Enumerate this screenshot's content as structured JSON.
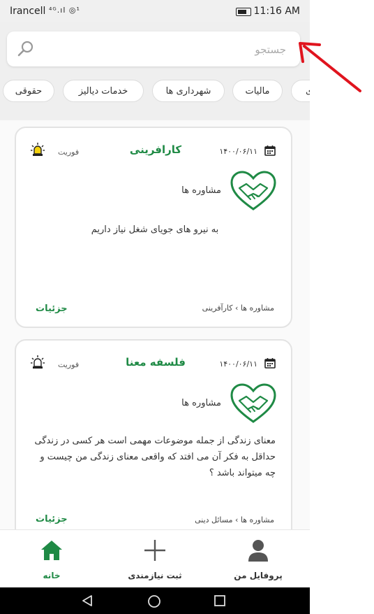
{
  "status_bar": {
    "carrier": "Irancell",
    "signal": "⁴ᴳ.ıl ◎¹",
    "time": "11:16 AM"
  },
  "search": {
    "placeholder": "جستجو",
    "value": ""
  },
  "categories": [
    "حقوقی",
    "خدمات دیالیز",
    "شهرداری ها",
    "مالیات",
    "ی"
  ],
  "cards": [
    {
      "date": "۱۴۰۰/۰۶/۱۱",
      "title": "کارافرینی",
      "urgent_label": "فوریت",
      "category": "مشاوره ها",
      "description": "به نیرو های جویای شغل نیاز داریم",
      "breadcrumb_parent": "مشاوره ها",
      "breadcrumb_sep": "›",
      "breadcrumb_child": "کارآفرینی",
      "details_label": "جزئیات"
    },
    {
      "date": "۱۴۰۰/۰۶/۱۱",
      "title": "فلسفه معنا",
      "urgent_label": "فوریت",
      "category": "مشاوره ها",
      "description": "معنای زندگی از جمله موضوعات مهمی است هر کسی در زندگی حداقل به فکر آن می افتد که واقعی معنای زندگی من چیست و چه میتواند باشد ؟",
      "breadcrumb_parent": "مشاوره ها",
      "breadcrumb_sep": "›",
      "breadcrumb_child": "مسائل دینی",
      "details_label": "جزئیات"
    }
  ],
  "bottom_nav": [
    {
      "label": "خانه",
      "icon": "home-icon",
      "active": true
    },
    {
      "label": "ثبت نیازمندی",
      "icon": "plus-icon",
      "active": false
    },
    {
      "label": "پروفایل من",
      "icon": "person-icon",
      "active": false
    }
  ],
  "colors": {
    "accent": "#1f8a45",
    "arrow": "#e0141e"
  }
}
